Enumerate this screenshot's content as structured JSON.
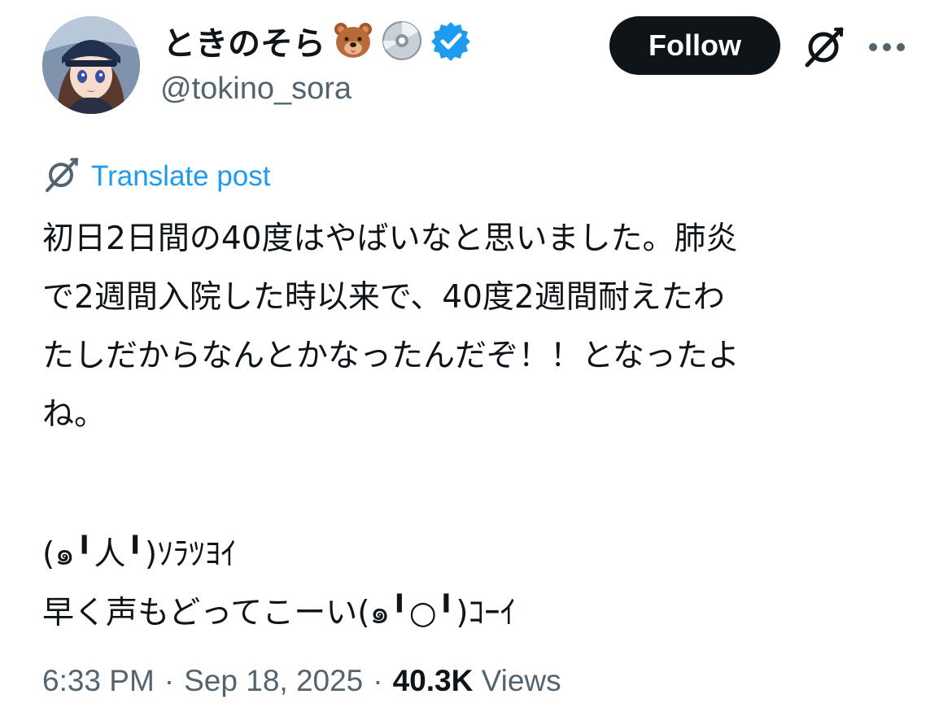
{
  "header": {
    "display_name": "ときのそら",
    "name_icons": [
      "bear-face-emoji",
      "optical-disc-emoji",
      "verified-badge-icon"
    ],
    "handle": "@tokino_sora",
    "follow_label": "Follow",
    "accent_color": "#1d9bf0"
  },
  "translate": {
    "label": "Translate post",
    "icon": "grok-icon"
  },
  "post": {
    "lines": [
      "初日2日間の40度はやばいなと思いました。肺炎",
      "で2週間入院した時以来で、40度2週間耐えたわ",
      "たしだからなんとかなったんだぞ！！となったよ",
      "ね。",
      "",
      "(๑╹人╹)ｿﾗﾂﾖｲ",
      "早く声もどってこーい(๑╹○╹)ｺｰｲ"
    ]
  },
  "meta": {
    "time": "6:33 PM",
    "date": "Sep 18, 2025",
    "views_count": "40.3K",
    "views_label": "Views",
    "separator": "·"
  }
}
